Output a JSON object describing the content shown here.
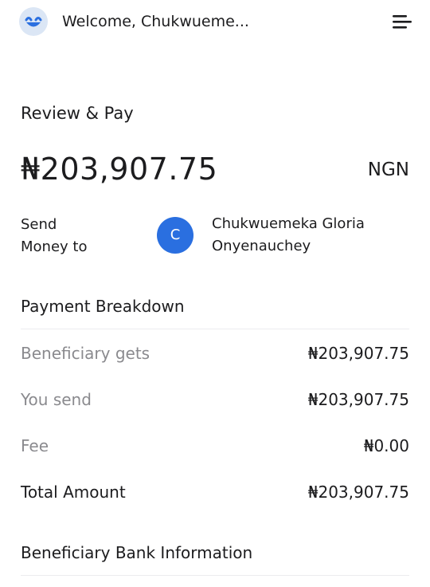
{
  "header": {
    "welcome": "Welcome, Chukwueme..."
  },
  "icons": {
    "logo": "smiley-logo-icon",
    "menu": "hamburger-menu-icon"
  },
  "colors": {
    "logo_bg": "#dbe6f5",
    "logo_fg": "#2a6fe0",
    "avatar_bg": "#2a6fe0",
    "muted_text": "#8a8a8e",
    "divider": "#ececef"
  },
  "review": {
    "title": "Review & Pay",
    "amount": "₦203,907.75",
    "currency": "NGN"
  },
  "recipient": {
    "send_label_line1": "Send",
    "send_label_line2": "Money to",
    "avatar_initial": "C",
    "name_line1": "Chukwuemeka Gloria",
    "name_line2": "Onyenauchey"
  },
  "breakdown": {
    "title": "Payment Breakdown",
    "rows": [
      {
        "label": "Beneficiary gets",
        "value": "₦203,907.75"
      },
      {
        "label": "You send",
        "value": "₦203,907.75"
      },
      {
        "label": "Fee",
        "value": "₦0.00"
      },
      {
        "label": "Total Amount",
        "value": "₦203,907.75"
      }
    ]
  },
  "bank_info": {
    "title": "Beneficiary Bank Information"
  }
}
